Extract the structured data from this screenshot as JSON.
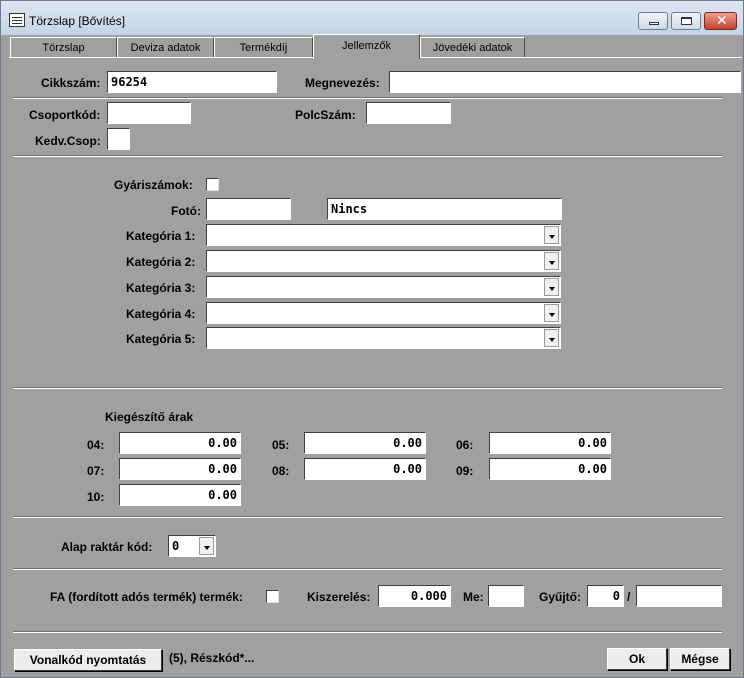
{
  "window": {
    "title": "Törzslap [Bővítés]"
  },
  "tabs": [
    {
      "label": "Törzslap"
    },
    {
      "label": "Deviza adatok"
    },
    {
      "label": "Termékdíj"
    },
    {
      "label": "Jellemzők",
      "active": true
    },
    {
      "label": "Jövedéki adatok"
    }
  ],
  "header": {
    "cikkszam_label": "Cikkszám:",
    "cikkszam_value": "96254",
    "megnevezes_label": "Megnevezés:",
    "megnevezes_value": ""
  },
  "codes": {
    "csoportkod_label": "Csoportkód:",
    "csoportkod_value": "",
    "polcszam_label": "PolcSzám:",
    "polcszam_value": "",
    "kedvcsop_label": "Kedv.Csop:",
    "kedvcsop_value": ""
  },
  "details": {
    "gyariszamok_label": "Gyáriszámok:",
    "gyariszamok_checked": false,
    "foto_label": "Fotó:",
    "foto_value": "",
    "foto_status": "Nincs",
    "kategoriak": [
      {
        "label": "Kategória 1:",
        "value": ""
      },
      {
        "label": "Kategória 2:",
        "value": ""
      },
      {
        "label": "Kategória 3:",
        "value": ""
      },
      {
        "label": "Kategória 4:",
        "value": ""
      },
      {
        "label": "Kategória 5:",
        "value": ""
      }
    ]
  },
  "prices": {
    "title": "Kiegészítő árak",
    "items": [
      {
        "label": "04:",
        "value": "0.00"
      },
      {
        "label": "05:",
        "value": "0.00"
      },
      {
        "label": "06:",
        "value": "0.00"
      },
      {
        "label": "07:",
        "value": "0.00"
      },
      {
        "label": "08:",
        "value": "0.00"
      },
      {
        "label": "09:",
        "value": "0.00"
      },
      {
        "label": "10:",
        "value": "0.00"
      }
    ]
  },
  "warehouse": {
    "label": "Alap raktár kód:",
    "value": "0"
  },
  "packaging": {
    "fa_label": "FA (fordított adós termék) termék:",
    "fa_checked": false,
    "kiszereles_label": "Kiszerelés:",
    "kiszereles_value": "0.000",
    "me_label": "Me:",
    "me_value": "",
    "gyujto_label": "Gyűjtő:",
    "gyujto_value": "0",
    "gyujto_separator": "/",
    "gyujto_value2": ""
  },
  "footer": {
    "barcode_button": "Vonalkód nyomtatás",
    "status_text": "(5), Részkód*...",
    "ok_button": "Ok",
    "cancel_button": "Mégse"
  }
}
